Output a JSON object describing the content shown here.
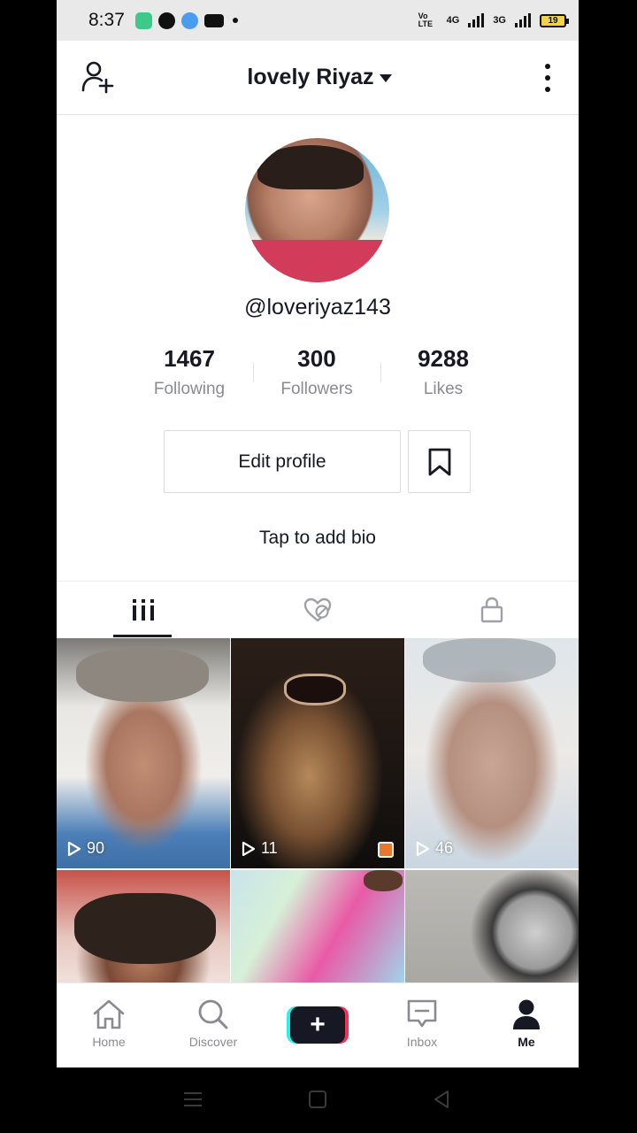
{
  "status_bar": {
    "time": "8:37",
    "network_label_1": "Vo LTE",
    "network_label_2": "4G",
    "network_label_3": "3G",
    "battery": "19"
  },
  "header": {
    "title": "lovely Riyaz"
  },
  "profile": {
    "username": "@loveriyaz143",
    "stats": [
      {
        "value": "1467",
        "label": "Following"
      },
      {
        "value": "300",
        "label": "Followers"
      },
      {
        "value": "9288",
        "label": "Likes"
      }
    ],
    "edit_label": "Edit profile",
    "bio_prompt": "Tap to add bio"
  },
  "videos": [
    {
      "count": "90",
      "badge": false
    },
    {
      "count": "11",
      "badge": true
    },
    {
      "count": "46",
      "badge": false
    },
    {
      "count": "",
      "badge": false
    },
    {
      "count": "",
      "badge": false
    },
    {
      "count": "",
      "badge": false
    }
  ],
  "nav": {
    "home": "Home",
    "discover": "Discover",
    "inbox": "Inbox",
    "me": "Me",
    "create": "+"
  },
  "colors": {
    "accent_red": "#fe2c55",
    "accent_cyan": "#25f4ee",
    "text_primary": "#161823",
    "text_secondary": "#8a8b91"
  }
}
